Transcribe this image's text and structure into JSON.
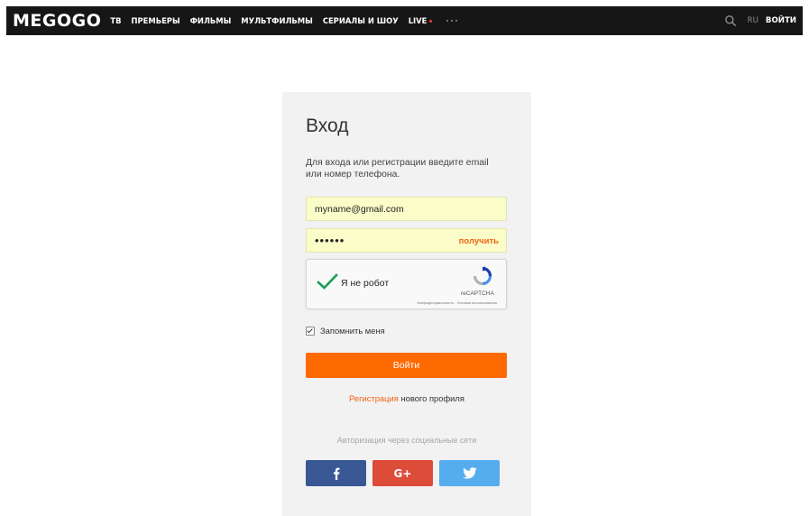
{
  "header": {
    "logo": "MEGOGO",
    "nav": [
      {
        "label": "ТВ"
      },
      {
        "label": "ПРЕМЬЕРЫ"
      },
      {
        "label": "ФИЛЬМЫ"
      },
      {
        "label": "МУЛЬТФИЛЬМЫ"
      },
      {
        "label": "СЕРИАЛЫ И ШОУ"
      },
      {
        "label": "LIVE"
      }
    ],
    "more_icon": "more-dots-icon",
    "search_icon": "search-icon",
    "language": "RU",
    "login_label": "ВОЙТИ",
    "live_dot_color": "#ff3b30"
  },
  "login": {
    "title": "Вход",
    "description": "Для входа или регистрации введите email или номер телефона.",
    "email_value": "myname@gmail.com",
    "password_value": "••••••",
    "get_code_label": "получить",
    "recaptcha": {
      "label": "Я не робот",
      "brand": "reCAPTCHA",
      "terms": "Конфиденциальность - Условия использования"
    },
    "remember_label": "Запомнить меня",
    "remember_checked": true,
    "submit_label": "Войти",
    "register_link": "Регистрация",
    "register_rest": " нового профиля",
    "social_label": "Авторизация через социальные сети",
    "social_google_label": "G+",
    "colors": {
      "accent": "#ff6a00",
      "field_bg": "#fafdc7",
      "facebook": "#3a5795",
      "google": "#dd4b39",
      "twitter": "#55acee"
    }
  }
}
